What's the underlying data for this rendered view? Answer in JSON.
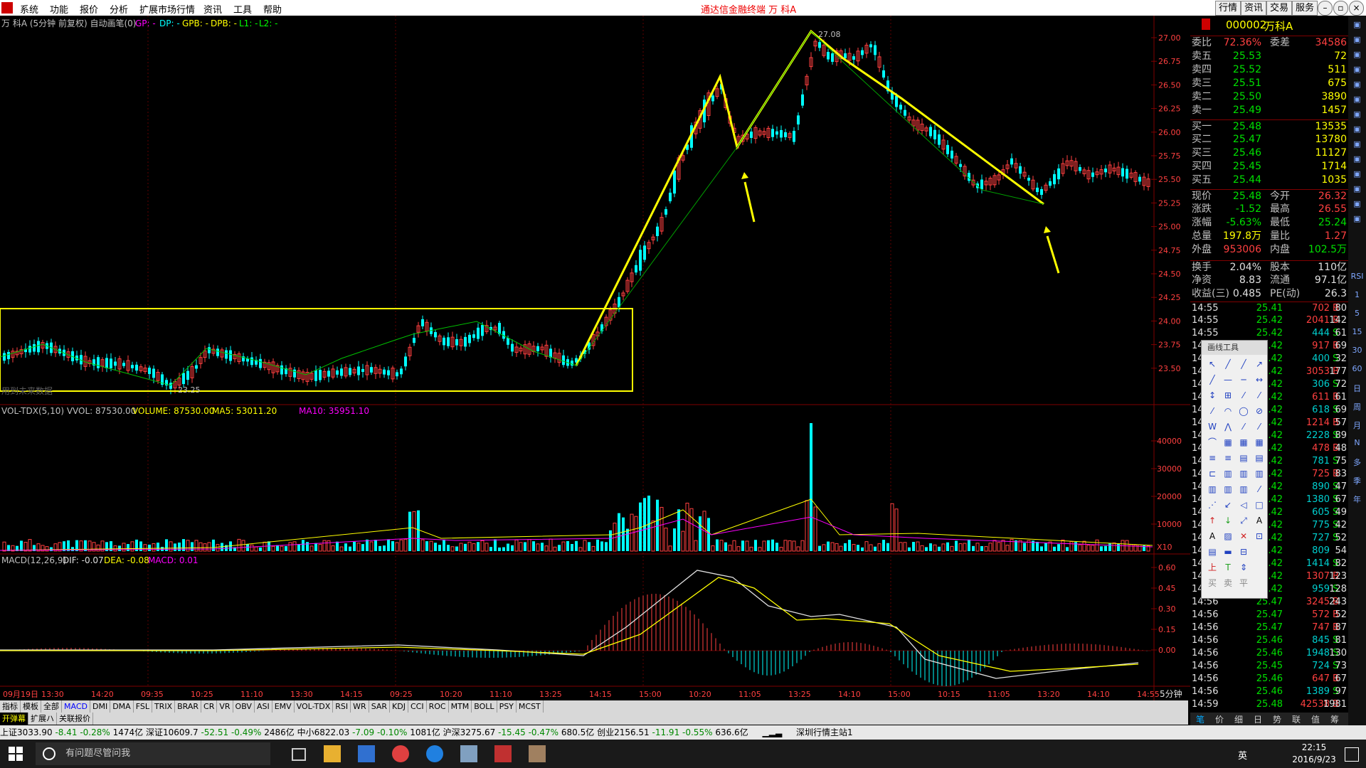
{
  "menu": {
    "items": [
      "系统",
      "功能",
      "报价",
      "分析",
      "扩展市场行情",
      "资讯",
      "工具",
      "帮助"
    ],
    "center": "通达信金融终端    万 科A",
    "right": [
      "行情",
      "资讯",
      "交易",
      "服务"
    ]
  },
  "chart": {
    "title": "万 科A (5分钟 前复权) 自动画笔(0)",
    "legend": [
      "GP: -",
      "DP: -",
      "GPB: -",
      "DPB: -",
      "L1: -",
      "L2: -"
    ],
    "price_labels": [
      "27.00",
      "26.75",
      "26.50",
      "26.25",
      "26.00",
      "25.75",
      "25.50",
      "25.25",
      "25.00",
      "24.75",
      "24.50",
      "24.25",
      "24.00",
      "23.75",
      "23.50"
    ],
    "high_label": "27.08",
    "low_label": "23.25",
    "watermark": "用到未来数据",
    "vol_header": "VOL-TDX(5,10) VVOL: 87530.00",
    "vol_header2": "VOLUME: 87530.00",
    "vol_ma5": "MA5: 53011.20",
    "vol_ma10": "MA10: 35951.10",
    "vol_labels": [
      "40000",
      "30000",
      "20000",
      "10000"
    ],
    "vol_unit": "X10",
    "macd_header": "MACD(12,26,9)",
    "macd_dif": "DIF: -0.07",
    "macd_dea": "DEA: -0.08",
    "macd_val": "MACD: 0.01",
    "macd_labels": [
      "0.60",
      "0.45",
      "0.30",
      "0.15",
      "0.00"
    ],
    "time_labels": [
      "09月19日",
      "13:30",
      "14:20",
      "09:35",
      "10:25",
      "11:10",
      "13:30",
      "14:15",
      "09:25",
      "10:20",
      "11:10",
      "13:25",
      "14:15",
      "15:00",
      "10:20",
      "11:05",
      "13:25",
      "14:10",
      "15:00",
      "10:15",
      "11:05",
      "13:20",
      "14:10",
      "14:55"
    ],
    "period": "5分钟"
  },
  "chart_data": {
    "type": "candlestick",
    "title": "万 科A (5分钟 前复权)",
    "y_range": [
      23.25,
      27.08
    ],
    "high": 27.08,
    "low": 23.25,
    "volume_last": 87530.0,
    "ma5": 53011.2,
    "ma10": 35951.1,
    "dif": -0.07,
    "dea": -0.08,
    "macd": 0.01
  },
  "quote": {
    "code": "000002",
    "name": "万科A",
    "weibi_label": "委比",
    "weibi": "72.36%",
    "weicha_label": "委差",
    "weicha": "34586",
    "sell": [
      {
        "l": "卖五",
        "p": "25.53",
        "v": "72"
      },
      {
        "l": "卖四",
        "p": "25.52",
        "v": "511"
      },
      {
        "l": "卖三",
        "p": "25.51",
        "v": "675"
      },
      {
        "l": "卖二",
        "p": "25.50",
        "v": "3890"
      },
      {
        "l": "卖一",
        "p": "25.49",
        "v": "1457"
      }
    ],
    "buy": [
      {
        "l": "买一",
        "p": "25.48",
        "v": "13535"
      },
      {
        "l": "买二",
        "p": "25.47",
        "v": "13780"
      },
      {
        "l": "买三",
        "p": "25.46",
        "v": "11127"
      },
      {
        "l": "买四",
        "p": "25.45",
        "v": "1714"
      },
      {
        "l": "买五",
        "p": "25.44",
        "v": "1035"
      }
    ],
    "stats": [
      {
        "a": "现价",
        "b": "25.48",
        "c": "今开",
        "d": "26.32"
      },
      {
        "a": "涨跌",
        "b": "-1.52",
        "c": "最高",
        "d": "26.55"
      },
      {
        "a": "涨幅",
        "b": "-5.63%",
        "c": "最低",
        "d": "25.24"
      },
      {
        "a": "总量",
        "b": "197.8万",
        "c": "量比",
        "d": "1.27"
      },
      {
        "a": "外盘",
        "b": "953006",
        "c": "内盘",
        "d": "102.5万"
      }
    ],
    "stats2": [
      {
        "a": "换手",
        "b": "2.04%",
        "c": "股本",
        "d": "110亿"
      },
      {
        "a": "净资",
        "b": "8.83",
        "c": "流通",
        "d": "97.1亿"
      },
      {
        "a": "收益(三)",
        "b": "0.485",
        "c": "PE(动)",
        "d": "26.3"
      }
    ],
    "ticks": [
      {
        "t": "14:55",
        "p": "25.41",
        "v": "702",
        "bs": "B",
        "n": "80"
      },
      {
        "t": "14:55",
        "p": "25.42",
        "v": "2041",
        "bs": "B",
        "n": "142"
      },
      {
        "t": "14:55",
        "p": "25.42",
        "v": "444",
        "bs": "S",
        "n": "61"
      },
      {
        "t": "14:55",
        "p": "25.42",
        "v": "917",
        "bs": "B",
        "n": "69"
      },
      {
        "t": "14:55",
        "p": "25.42",
        "v": "400",
        "bs": "S",
        "n": "32"
      },
      {
        "t": "14:55",
        "p": "25.42",
        "v": "3053",
        "bs": "B",
        "n": "177"
      },
      {
        "t": "14:55",
        "p": "25.42",
        "v": "306",
        "bs": "S",
        "n": "72"
      },
      {
        "t": "14:55",
        "p": "25.42",
        "v": "611",
        "bs": "B",
        "n": "61"
      },
      {
        "t": "14:55",
        "p": "25.42",
        "v": "618",
        "bs": "S",
        "n": "69"
      },
      {
        "t": "14:55",
        "p": "25.42",
        "v": "1214",
        "bs": "B",
        "n": "57"
      },
      {
        "t": "14:55",
        "p": "25.42",
        "v": "2228",
        "bs": "S",
        "n": "89"
      },
      {
        "t": "14:55",
        "p": "25.42",
        "v": "478",
        "bs": "B",
        "n": "48"
      },
      {
        "t": "14:55",
        "p": "25.42",
        "v": "781",
        "bs": "S",
        "n": "75"
      },
      {
        "t": "14:55",
        "p": "25.42",
        "v": "725",
        "bs": "B",
        "n": "83"
      },
      {
        "t": "14:55",
        "p": "25.42",
        "v": "890",
        "bs": "S",
        "n": "47"
      },
      {
        "t": "14:55",
        "p": "25.42",
        "v": "1380",
        "bs": "S",
        "n": "67"
      },
      {
        "t": "14:55",
        "p": "25.42",
        "v": "605",
        "bs": "S",
        "n": "49"
      },
      {
        "t": "14:55",
        "p": "25.42",
        "v": "775",
        "bs": "S",
        "n": "42"
      },
      {
        "t": "14:55",
        "p": "25.42",
        "v": "727",
        "bs": "S",
        "n": "52"
      },
      {
        "t": "14:55",
        "p": "25.42",
        "v": "809",
        "bs": "",
        "n": "54"
      },
      {
        "t": "14:55",
        "p": "25.42",
        "v": "1414",
        "bs": "S",
        "n": "82"
      },
      {
        "t": "14:55",
        "p": "25.42",
        "v": "1307",
        "bs": "B",
        "n": "123"
      },
      {
        "t": "14:55",
        "p": "25.42",
        "v": "959",
        "bs": "S",
        "n": "128"
      },
      {
        "t": "14:56",
        "p": "25.47",
        "v": "3245",
        "bs": "B",
        "n": "243"
      },
      {
        "t": "14:56",
        "p": "25.47",
        "v": "572",
        "bs": "B",
        "n": "52"
      },
      {
        "t": "14:56",
        "p": "25.47",
        "v": "747",
        "bs": "B",
        "n": "87"
      },
      {
        "t": "14:56",
        "p": "25.46",
        "v": "845",
        "bs": "S",
        "n": "81"
      },
      {
        "t": "14:56",
        "p": "25.46",
        "v": "1948",
        "bs": "S",
        "n": "130"
      },
      {
        "t": "14:56",
        "p": "25.45",
        "v": "724",
        "bs": "S",
        "n": "73"
      },
      {
        "t": "14:56",
        "p": "25.46",
        "v": "647",
        "bs": "B",
        "n": "67"
      },
      {
        "t": "14:56",
        "p": "25.46",
        "v": "1389",
        "bs": "S",
        "n": "97"
      },
      {
        "t": "14:59",
        "p": "25.48",
        "v": "42538",
        "bs": "B",
        "n": "1981"
      }
    ]
  },
  "toolbox": {
    "title": "画线工具"
  },
  "sidebar": [
    "RSI",
    "1",
    "5",
    "15",
    "30",
    "60",
    "日",
    "周",
    "月",
    "N",
    "多",
    "季",
    "年"
  ],
  "tabs1": [
    "指标",
    "模板",
    "全部",
    "MACD",
    "DMI",
    "DMA",
    "FSL",
    "TRIX",
    "BRAR",
    "CR",
    "VR",
    "OBV",
    "ASI",
    "EMV",
    "VOL-TDX",
    "RSI",
    "WR",
    "SAR",
    "KDJ",
    "CCI",
    "ROC",
    "MTM",
    "BOLL",
    "PSY",
    "MCST"
  ],
  "tabs2": [
    "开弹幕",
    "扩展ハ",
    "关联报价"
  ],
  "rp_tabs": [
    "笔",
    "价",
    "细",
    "日",
    "势",
    "联",
    "值",
    "筹"
  ],
  "status": {
    "sh": "上证3033.90",
    "sh_chg": "-8.41",
    "sh_pct": "-0.28%",
    "sh_amt": "1474亿",
    "sz": "深证10609.7",
    "sz_chg": "-52.51",
    "sz_pct": "-0.49%",
    "sz_amt": "2486亿",
    "zx": "中小6822.03",
    "zx_chg": "-7.09",
    "zx_pct": "-0.10%",
    "zx_amt": "1081亿",
    "hs": "沪深3275.67",
    "hs_chg": "-15.45",
    "hs_pct": "-0.47%",
    "hs_amt": "680.5亿",
    "cy": "创业2156.51",
    "cy_chg": "-11.91",
    "cy_pct": "-0.55%",
    "cy_amt": "636.6亿",
    "station": "深圳行情主站1"
  },
  "taskbar": {
    "search": "有问题尽管问我",
    "time": "22:15",
    "date": "2016/9/23",
    "ime": "英"
  }
}
